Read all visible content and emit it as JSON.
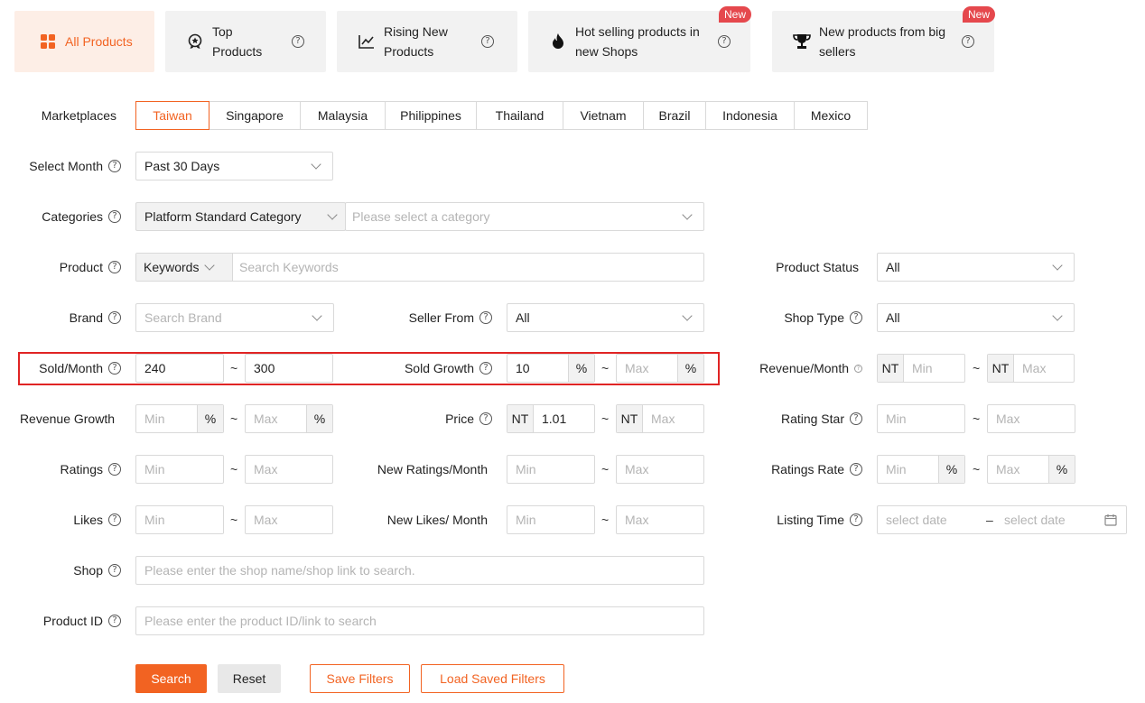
{
  "tabs": [
    {
      "label": "All Products",
      "icon": "grid-icon",
      "active": true
    },
    {
      "label": "Top Products",
      "icon": "medal-icon"
    },
    {
      "label": "Rising New Products",
      "icon": "trend-chart-icon"
    },
    {
      "label": "Hot selling products in new Shops",
      "icon": "flame-icon",
      "badge": "New"
    },
    {
      "label": "New products from big sellers",
      "icon": "trophy-icon",
      "badge": "New"
    }
  ],
  "help_glyph": "?",
  "range_sep": "~",
  "labels": {
    "marketplaces": "Marketplaces",
    "select_month": "Select Month",
    "categories": "Categories",
    "product": "Product",
    "product_status": "Product Status",
    "brand": "Brand",
    "seller_from": "Seller From",
    "shop_type": "Shop Type",
    "sold_month": "Sold/Month",
    "sold_growth": "Sold Growth",
    "revenue_month": "Revenue/Month",
    "revenue_growth": "Revenue Growth",
    "price": "Price",
    "rating_star": "Rating Star",
    "ratings": "Ratings",
    "new_ratings_month": "New Ratings/Month",
    "ratings_rate": "Ratings Rate",
    "likes": "Likes",
    "new_likes_month": "New Likes/ Month",
    "listing_time": "Listing Time",
    "shop": "Shop",
    "product_id": "Product ID"
  },
  "marketplaces": [
    "Taiwan",
    "Singapore",
    "Malaysia",
    "Philippines",
    "Thailand",
    "Vietnam",
    "Brazil",
    "Indonesia",
    "Mexico"
  ],
  "selected_marketplace": "Taiwan",
  "fields": {
    "select_month": "Past 30 Days",
    "category_type": "Platform Standard Category",
    "category_placeholder": "Please select a category",
    "product_mode": "Keywords",
    "keywords_placeholder": "Search Keywords",
    "product_status": "All",
    "brand_placeholder": "Search Brand",
    "seller_from": "All",
    "shop_type": "All",
    "sold_min": "240",
    "sold_max": "300",
    "sold_growth_min": "10",
    "revenue_growth_min": "",
    "price_min": "1.01",
    "shop_placeholder": "Please enter the shop name/shop link to search.",
    "product_id_placeholder": "Please enter the product ID/link to search",
    "date_start_placeholder": "select date",
    "date_end_placeholder": "select date",
    "date_sep": "–",
    "min": "Min",
    "max": "Max",
    "percent": "%",
    "currency": "NT"
  },
  "buttons": {
    "search": "Search",
    "reset": "Reset",
    "save_filters": "Save Filters",
    "load_saved_filters": "Load Saved Filters"
  },
  "colors": {
    "accent": "#f26322",
    "badge": "#e5484d",
    "highlight": "#e02424"
  }
}
